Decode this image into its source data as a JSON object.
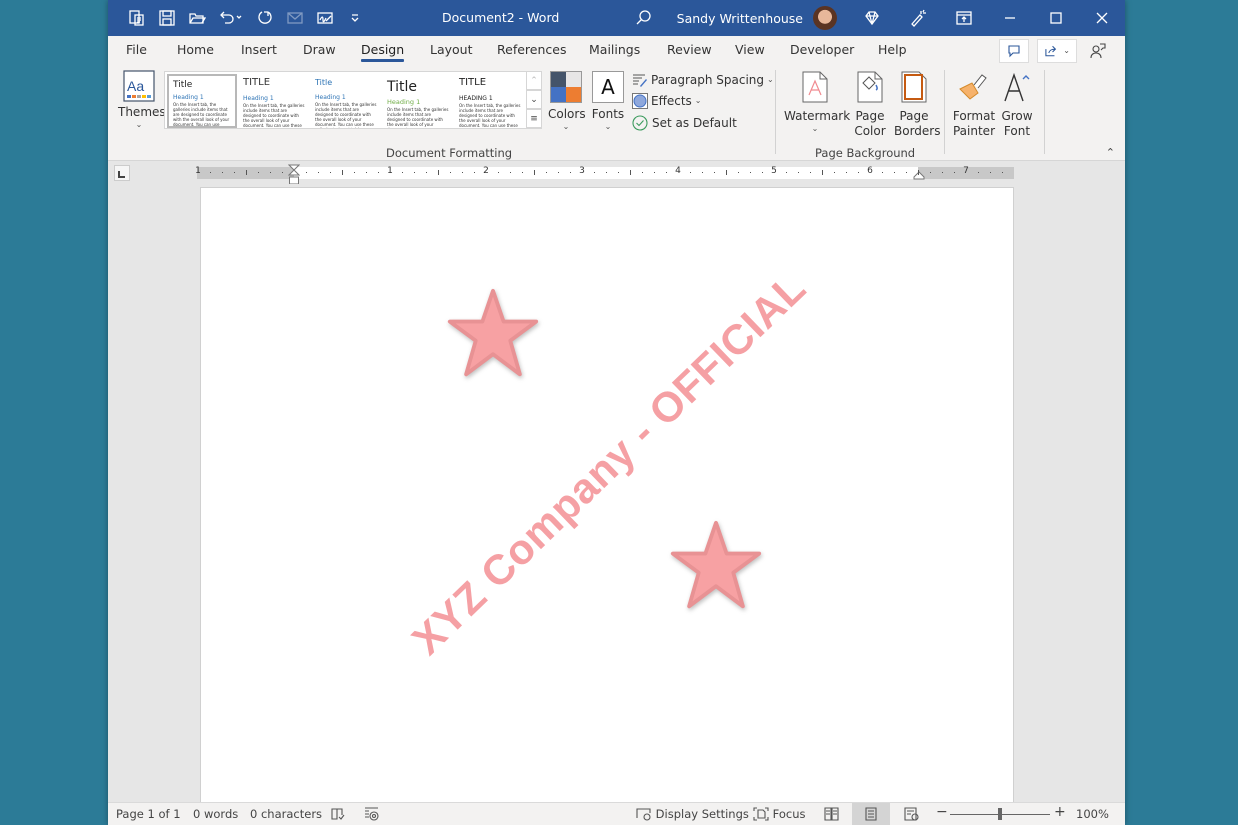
{
  "window": {
    "document_title": "Document2  -  Word",
    "user_name": "Sandy Writtenhouse"
  },
  "quick_access": [
    {
      "icon": "new-from-template-icon"
    },
    {
      "icon": "save-icon"
    },
    {
      "icon": "open-folder-icon"
    },
    {
      "icon": "undo-icon"
    },
    {
      "icon": "redo-icon"
    },
    {
      "icon": "email-icon",
      "disabled": true
    },
    {
      "icon": "signature-icon"
    },
    {
      "icon": "customize-qat-icon"
    }
  ],
  "tabs": [
    {
      "label": "File"
    },
    {
      "label": "Home"
    },
    {
      "label": "Insert"
    },
    {
      "label": "Draw"
    },
    {
      "label": "Design",
      "active": true
    },
    {
      "label": "Layout"
    },
    {
      "label": "References"
    },
    {
      "label": "Mailings"
    },
    {
      "label": "Review"
    },
    {
      "label": "View"
    },
    {
      "label": "Developer"
    },
    {
      "label": "Help"
    }
  ],
  "ribbon": {
    "themes_label": "Themes",
    "gallery": [
      {
        "title": "Title",
        "heading": "Heading 1",
        "body": "On the Insert tab, the galleries include items that are designed to coordinate with the overall look of your document. You can use these galleries to insert tables, headers, footers, lists, cover pages.",
        "selected": true
      },
      {
        "title": "TITLE",
        "heading": "Heading 1",
        "body": "On the Insert tab, the galleries include items that are designed to coordinate with the overall look of your document. You can use these galleries to insert"
      },
      {
        "title": "Title",
        "heading": "Heading 1",
        "body": "On the Insert tab, the galleries include items that are designed to coordinate with the overall look of your document. You can use these galleries to insert tables, headers, footers, lists, cover pages, and other"
      },
      {
        "title": "Title",
        "heading": "Heading 1",
        "body": "On the Insert tab, the galleries include items that are designed to coordinate with the overall look of your document."
      },
      {
        "title": "TITLE",
        "heading": "HEADING 1",
        "body": "On the Insert tab, the galleries include items that are designed to coordinate with the overall look of your document. You can use these galleries to insert"
      }
    ],
    "document_formatting_label": "Document Formatting",
    "colors_label": "Colors",
    "fonts_label": "Fonts",
    "paragraph_spacing_label": "Paragraph Spacing",
    "effects_label": "Effects",
    "set_as_default_label": "Set as Default",
    "watermark_label": "Watermark",
    "page_color_label_1": "Page",
    "page_color_label_2": "Color",
    "page_borders_label_1": "Page",
    "page_borders_label_2": "Borders",
    "page_background_label": "Page Background",
    "format_painter_label_1": "Format",
    "format_painter_label_2": "Painter",
    "grow_font_label_1": "Grow",
    "grow_font_label_2": "Font",
    "theme_colors": [
      "#44546a",
      "#e7e6e6",
      "#4472c4",
      "#ed7d31"
    ]
  },
  "ruler": {
    "numbers": [
      "1",
      "1",
      "2",
      "3",
      "4",
      "5",
      "6",
      "7"
    ]
  },
  "document": {
    "watermark_text": "XYZ Company - OFFICIAL",
    "watermark_color": "#f5a0a4",
    "star_color": "#f7a1a3"
  },
  "status": {
    "page": "Page 1 of 1",
    "words": "0 words",
    "characters": "0 characters",
    "display_settings": "Display Settings",
    "focus": "Focus",
    "zoom_percent": "100%",
    "zoom_level": 1.0
  }
}
